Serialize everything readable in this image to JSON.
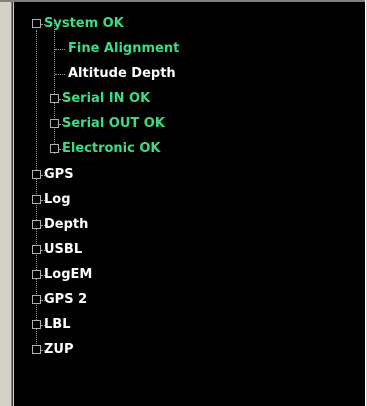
{
  "colors": {
    "ok_text": "#3ddc84",
    "normal_text": "#ffffff",
    "background": "#000000"
  },
  "tree": {
    "root": {
      "label": "System OK",
      "status": "ok",
      "expanded": true
    },
    "children": [
      {
        "label": "Fine Alignment",
        "status": "ok",
        "has_children": false
      },
      {
        "label": "Altitude Depth",
        "status": "normal",
        "has_children": false
      },
      {
        "label": "Serial IN OK",
        "status": "ok",
        "has_children": true
      },
      {
        "label": "Serial OUT OK",
        "status": "ok",
        "has_children": true
      },
      {
        "label": "Electronic OK",
        "status": "ok",
        "has_children": true
      }
    ],
    "top_items": [
      {
        "label": "GPS"
      },
      {
        "label": "Log"
      },
      {
        "label": "Depth"
      },
      {
        "label": "USBL"
      },
      {
        "label": "LogEM"
      },
      {
        "label": "GPS 2"
      },
      {
        "label": "LBL"
      },
      {
        "label": "ZUP"
      }
    ]
  }
}
